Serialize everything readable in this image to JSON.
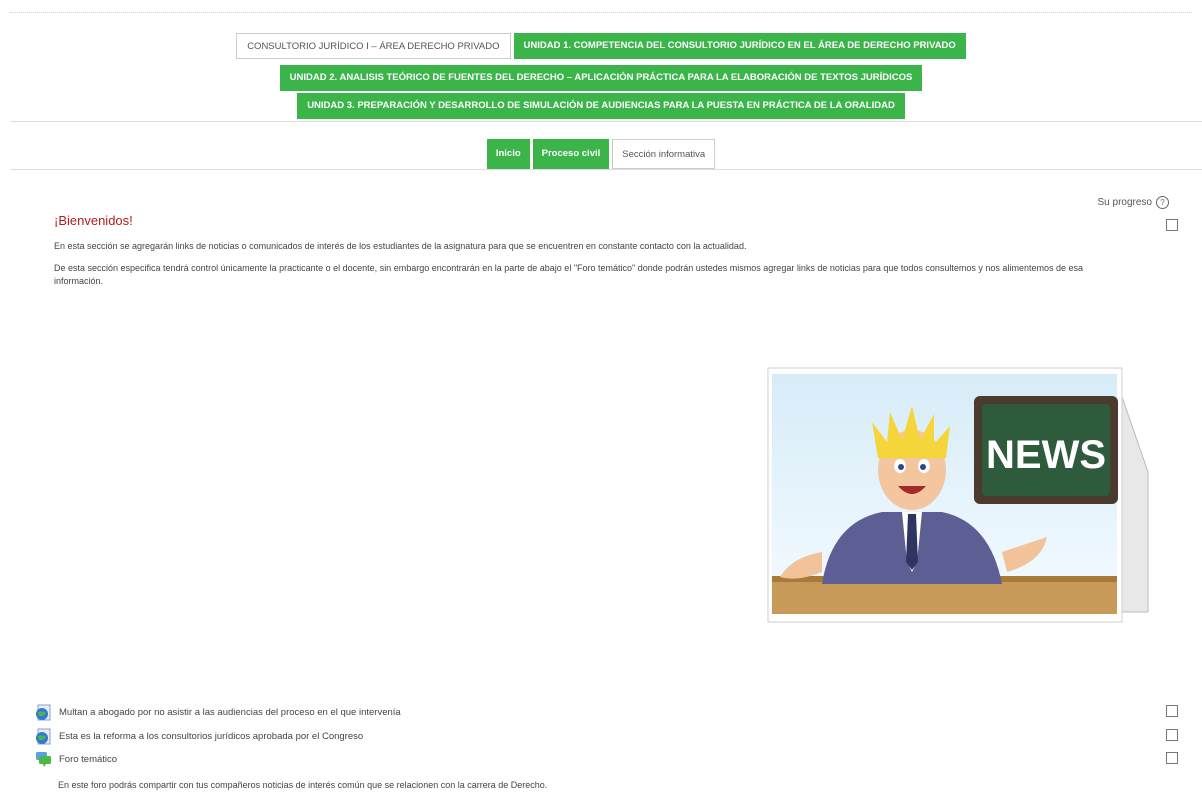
{
  "course_tabs": {
    "row1": [
      {
        "label": "CONSULTORIO JURÍDICO I – ÁREA DERECHO PRIVADO",
        "style": "white"
      },
      {
        "label": "UNIDAD 1. COMPETENCIA DEL CONSULTORIO JURÍDICO EN EL ÁREA DE DERECHO PRIVADO",
        "style": "green"
      }
    ],
    "row2": [
      {
        "label": "UNIDAD 2. ANALISIS TEÓRICO DE FUENTES DEL DERECHO – APLICACIÓN PRÁCTICA PARA LA ELABORACIÓN DE TEXTOS JURÍDICOS",
        "style": "green"
      }
    ],
    "row3": [
      {
        "label": "UNIDAD 3. PREPARACIÓN Y DESARROLLO DE SIMULACIÓN DE AUDIENCIAS PARA LA PUESTA EN PRÁCTICA DE LA ORALIDAD",
        "style": "green"
      }
    ]
  },
  "sub_tabs": [
    {
      "label": "Inicio",
      "style": "green"
    },
    {
      "label": "Proceso civil",
      "style": "green"
    },
    {
      "label": "Sección informativa",
      "style": "white"
    }
  ],
  "progress": {
    "label": "Su progreso",
    "help_icon": "question-circle-icon"
  },
  "section": {
    "title": "¡Bienvenidos!",
    "paragraph1": "En esta sección se agregarán links de noticias o comunicados de interés de los estudiantes de la asignatura para que se encuentren en constante contacto con la actualidad.",
    "paragraph2": "De esta sección especifica tendrá control únicamente la practicante o el docente, sin embargo encontrarán en la parte de abajo el \"Foro temático\" donde podrán ustedes mismos agregar links de noticias para que todos consultemos y nos alimentemos de esa información.",
    "image_text": "NEWS"
  },
  "activities": [
    {
      "label": "Multan a abogado por no asistir a las audiencias del proceso en el que intervenía",
      "icon": "url-resource-icon",
      "completed": false
    },
    {
      "label": "Esta es la reforma a los consultorios jurídicos aprobada por el Congreso",
      "icon": "url-resource-icon",
      "completed": false
    },
    {
      "label": "Foro temático",
      "icon": "forum-icon",
      "completed": false
    }
  ],
  "forum_description": "En este foro podrás compartir con tus compañeros noticias de interés común que se relacionen con la carrera de Derecho.",
  "colors": {
    "tab_green": "#3bb44a",
    "title_red": "#b11d1d"
  }
}
